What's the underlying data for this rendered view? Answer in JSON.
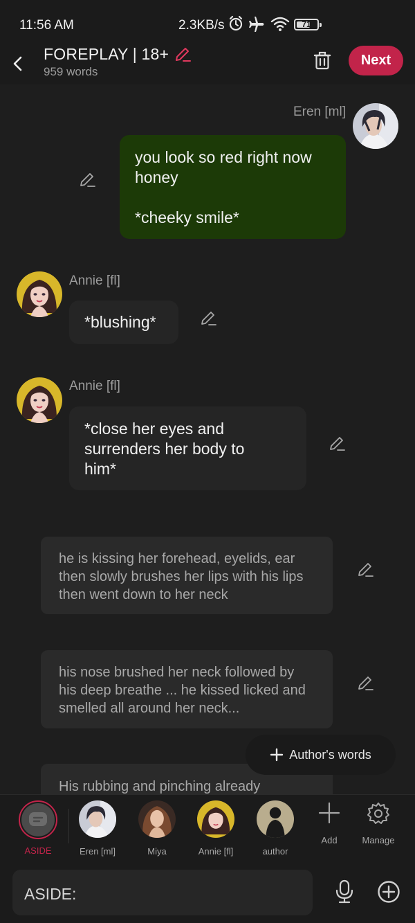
{
  "status_bar": {
    "time": "11:56 AM",
    "network_speed": "2.3KB/s",
    "battery_level": "71",
    "icons": [
      "alarm-icon",
      "airplane-icon",
      "wifi-icon",
      "battery-icon"
    ]
  },
  "header": {
    "title": "FOREPLAY | 18+",
    "word_count": "959 words",
    "next_label": "Next"
  },
  "messages": [
    {
      "sender": "Eren [ml]",
      "side": "right",
      "text": "you look so red right now\nhoney\n\n*cheeky smile*"
    },
    {
      "sender": "Annie [fl]",
      "side": "left",
      "text": "*blushing*"
    },
    {
      "sender": "Annie [fl]",
      "side": "left",
      "text": "*close her eyes and\nsurrenders her body to\nhim*"
    }
  ],
  "narrations": [
    {
      "text": "he is kissing her forehead, eyelids, ear then slowly brushes her lips with his lips then went down to her neck"
    },
    {
      "text": "his nose brushed her neck followed by his deep breathe ... he kissed licked and smelled all around her neck..."
    },
    {
      "text": "His rubbing and pinching already"
    }
  ],
  "authors_words_label": "Author's words",
  "character_bar": {
    "characters": [
      {
        "label": "ASIDE"
      },
      {
        "label": "Eren [ml]"
      },
      {
        "label": "Miya"
      },
      {
        "label": "Annie [fl]"
      },
      {
        "label": "author"
      }
    ],
    "add_label": "Add",
    "manage_label": "Manage"
  },
  "composer": {
    "prefix": "ASIDE:",
    "value": ""
  },
  "colors": {
    "accent": "#c2244a",
    "my_bubble": "#1c3a07",
    "other_bubble": "#252525",
    "background": "#1e1e1e"
  }
}
